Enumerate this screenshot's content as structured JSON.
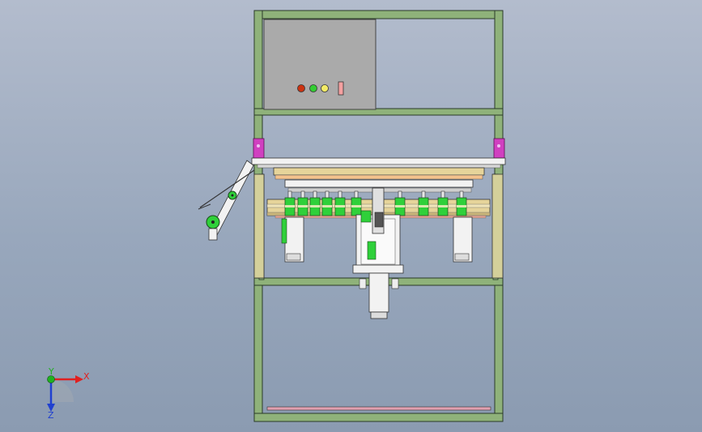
{
  "view": {
    "background_top": "#b3bccd",
    "background_bottom": "#8b9bb1"
  },
  "colors": {
    "frame": "#8fb27a",
    "frame_edge": "#2a3a28",
    "panel": "#aaaaaa",
    "magenta": "#d040c0",
    "olive": "#d4d09a",
    "rail": "#e6d49a",
    "green": "#2fd03a",
    "white_part": "#f2f2f2",
    "light_red": "#f0a0a0"
  },
  "control_panel": {
    "indicators": [
      {
        "name": "red-indicator",
        "color": "#cc3311"
      },
      {
        "name": "green-indicator",
        "color": "#33cc33"
      },
      {
        "name": "yellow-indicator",
        "color": "#f2ea66"
      }
    ],
    "switch_color": "#f4a0a0"
  },
  "triad": {
    "x_label": "X",
    "y_label": "Y",
    "z_label": "Z",
    "x_color": "#e02020",
    "y_color": "#20b020",
    "z_color": "#2040d0"
  }
}
